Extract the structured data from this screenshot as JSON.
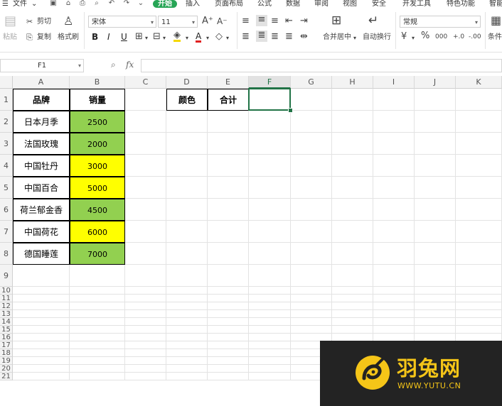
{
  "menu": {
    "file": "文件",
    "tabs": [
      "开始",
      "插入",
      "页面布局",
      "公式",
      "数据",
      "审阅",
      "视图",
      "安全",
      "开发工具",
      "特色功能",
      "智能"
    ],
    "active_tab": "开始"
  },
  "ribbon": {
    "paste": "粘贴",
    "cut": "剪切",
    "copy": "复制",
    "format_painter": "格式刷",
    "font_name": "宋体",
    "font_size": "11",
    "bold": "B",
    "italic": "I",
    "underline": "U",
    "font_color_glyph": "A",
    "grow_font": "A⁺",
    "shrink_font": "A⁻",
    "merge_center": "合并居中",
    "wrap_text": "自动换行",
    "number_format": "常规",
    "percent": "%",
    "thousands": "000",
    "inc_decimal": "+.0",
    "dec_decimal": "-.00",
    "conditional": "条件"
  },
  "formula_bar": {
    "name_box": "F1",
    "fx": "fx",
    "formula": ""
  },
  "sheet": {
    "columns": [
      "A",
      "B",
      "C",
      "D",
      "E",
      "F",
      "G",
      "H",
      "I",
      "J",
      "K"
    ],
    "selected_column": "F",
    "rows": [
      "1",
      "2",
      "3",
      "4",
      "5",
      "6",
      "7",
      "8",
      "9",
      "10",
      "11",
      "12",
      "13",
      "14",
      "15",
      "16",
      "17",
      "18",
      "19",
      "20",
      "21"
    ],
    "headers": {
      "brand": "品牌",
      "sales": "销量",
      "color": "颜色",
      "total": "合计"
    },
    "data": [
      {
        "brand": "日本月季",
        "sales": "2500",
        "fill": "green"
      },
      {
        "brand": "法国玫瑰",
        "sales": "2000",
        "fill": "green"
      },
      {
        "brand": "中国牡丹",
        "sales": "3000",
        "fill": "yellow"
      },
      {
        "brand": "中国百合",
        "sales": "5000",
        "fill": "yellow"
      },
      {
        "brand": "荷兰郁金香",
        "sales": "4500",
        "fill": "green"
      },
      {
        "brand": "中国荷花",
        "sales": "6000",
        "fill": "yellow"
      },
      {
        "brand": "德国睡莲",
        "sales": "7000",
        "fill": "green"
      }
    ],
    "fill_colors": {
      "green": "#92d050",
      "yellow": "#ffff00"
    },
    "active_cell": "F1"
  },
  "watermark": {
    "name": "羽兔网",
    "url": "WWW.YUTU.CN",
    "color": "#f5c518",
    "background": "#232323"
  }
}
